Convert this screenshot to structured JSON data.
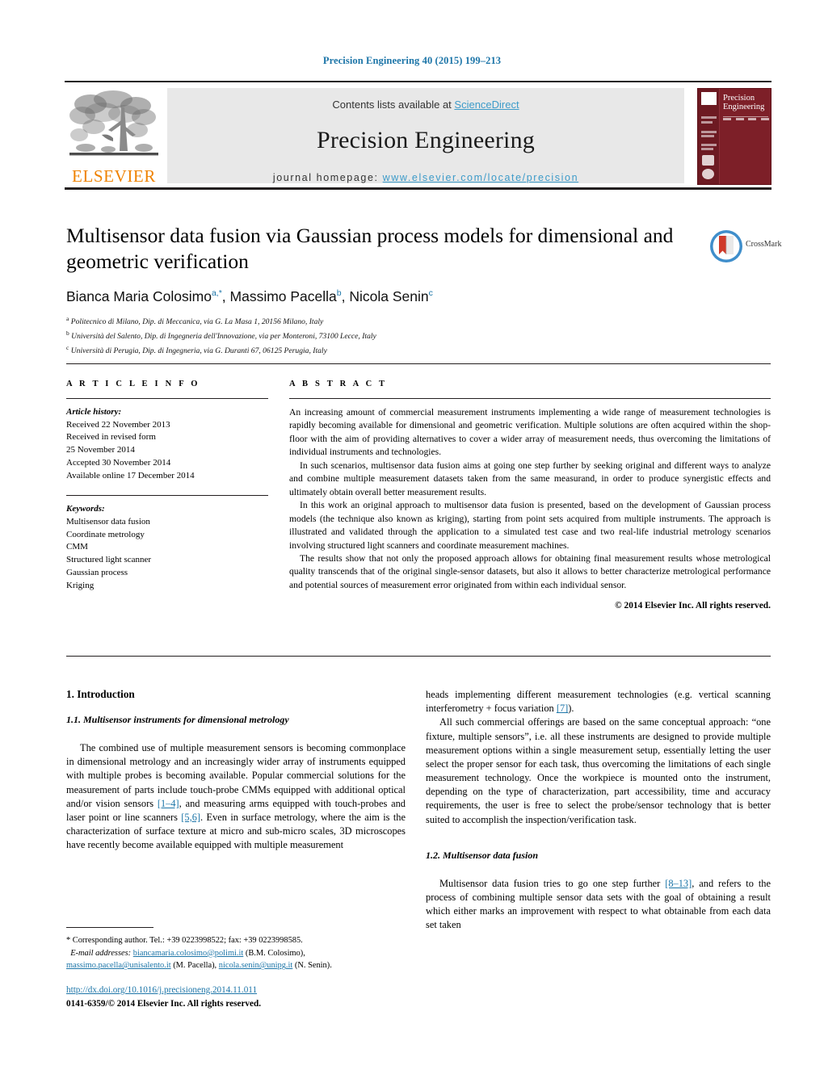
{
  "running_head": "Precision Engineering 40 (2015) 199–213",
  "masthead": {
    "contents_prefix": "Contents lists available at ",
    "contents_link": "ScienceDirect",
    "journal_title": "Precision Engineering",
    "homepage_prefix": "journal homepage: ",
    "homepage_url": "www.elsevier.com/locate/precision",
    "publisher_wordmark": "ELSEVIER",
    "cover_title_line1": "Precision",
    "cover_title_line2": "Engineering"
  },
  "article": {
    "title": "Multisensor data fusion via Gaussian process models for dimensional and geometric verification",
    "crossmark_label": "CrossMark",
    "authors": [
      {
        "name": "Bianca Maria Colosimo",
        "marks": "a,*"
      },
      {
        "name": "Massimo Pacella",
        "marks": "b"
      },
      {
        "name": "Nicola Senin",
        "marks": "c"
      }
    ],
    "authors_separator": ", ",
    "affiliations": [
      {
        "mark": "a",
        "text": "Politecnico di Milano, Dip. di Meccanica, via G. La Masa 1, 20156 Milano, Italy"
      },
      {
        "mark": "b",
        "text": "Università del Salento, Dip. di Ingegneria dell'Innovazione, via per Monteroni, 73100 Lecce, Italy"
      },
      {
        "mark": "c",
        "text": "Università di Perugia, Dip. di Ingegneria, via G. Duranti 67, 06125 Perugia, Italy"
      }
    ]
  },
  "article_info": {
    "heading": "A R T I C L E   I N F O",
    "history_label": "Article history:",
    "history": [
      "Received 22 November 2013",
      "Received in revised form",
      "25 November 2014",
      "Accepted 30 November 2014",
      "Available online 17 December 2014"
    ],
    "keywords_label": "Keywords:",
    "keywords": [
      "Multisensor data fusion",
      "Coordinate metrology",
      "CMM",
      "Structured light scanner",
      "Gaussian process",
      "Kriging"
    ]
  },
  "abstract": {
    "heading": "A B S T R A C T",
    "paragraphs": [
      "An increasing amount of commercial measurement instruments implementing a wide range of measurement technologies is rapidly becoming available for dimensional and geometric verification. Multiple solutions are often acquired within the shop-floor with the aim of providing alternatives to cover a wider array of measurement needs, thus overcoming the limitations of individual instruments and technologies.",
      "In such scenarios, multisensor data fusion aims at going one step further by seeking original and different ways to analyze and combine multiple measurement datasets taken from the same measurand, in order to produce synergistic effects and ultimately obtain overall better measurement results.",
      "In this work an original approach to multisensor data fusion is presented, based on the development of Gaussian process models (the technique also known as kriging), starting from point sets acquired from multiple instruments. The approach is illustrated and validated through the application to a simulated test case and two real-life industrial metrology scenarios involving structured light scanners and coordinate measurement machines.",
      "The results show that not only the proposed approach allows for obtaining final measurement results whose metrological quality transcends that of the original single-sensor datasets, but also it allows to better characterize metrological performance and potential sources of measurement error originated from within each individual sensor."
    ],
    "copyright": "© 2014 Elsevier Inc. All rights reserved."
  },
  "body": {
    "section1_heading": "1. Introduction",
    "section11_heading": "1.1. Multisensor instruments for dimensional metrology",
    "section12_heading": "1.2. Multisensor data fusion",
    "left_para_1a": "The combined use of multiple measurement sensors is becoming commonplace in dimensional metrology and an increasingly wider array of instruments equipped with multiple probes is becoming available. Popular commercial solutions for the measurement of parts include touch-probe CMMs equipped with additional optical and/or vision sensors ",
    "left_ref_1_4": "[1–4]",
    "left_para_1b": ", and measuring arms equipped with touch-probes and laser point or line scanners ",
    "left_ref_5_6": "[5,6]",
    "left_para_1c": ". Even in surface metrology, where the aim is the characterization of surface texture at micro and sub-micro scales, 3D microscopes have recently become available equipped with multiple measurement",
    "right_para_1a": "heads implementing different measurement technologies (e.g. vertical scanning interferometry + focus variation ",
    "right_ref_7": "[7]",
    "right_para_1b": ").",
    "right_para_2": "All such commercial offerings are based on the same conceptual approach: “one fixture, multiple sensors”, i.e. all these instruments are designed to provide multiple measurement options within a single measurement setup, essentially letting the user select the proper sensor for each task, thus overcoming the limitations of each single measurement technology. Once the workpiece is mounted onto the instrument, depending on the type of characterization, part accessibility, time and accuracy requirements, the user is free to select the probe/sensor technology that is better suited to accomplish the inspection/verification task.",
    "right_para_3a": "Multisensor data fusion tries to go one step further ",
    "right_ref_8_13": "[8–13]",
    "right_para_3b": ", and refers to the process of combining multiple sensor data sets with the goal of obtaining a result which either marks an improvement with respect to what obtainable from each data set taken"
  },
  "footnote": {
    "corresponding": "* Corresponding author. Tel.: +39 0223998522; fax: +39 0223998585.",
    "email_label": "E-mail addresses:",
    "email1": "biancamaria.colosimo@polimi.it",
    "email1_name": " (B.M. Colosimo),",
    "email2": "massimo.pacella@unisalento.it",
    "email2_name": " (M. Pacella),",
    "email3": "nicola.senin@unipg.it",
    "email3_name": " (N. Senin).",
    "doi": "http://dx.doi.org/10.1016/j.precisioneng.2014.11.011",
    "issn": "0141-6359/© 2014 Elsevier Inc. All rights reserved."
  },
  "colors": {
    "link_blue": "#1c75a8",
    "sciencedirect_blue": "#3d9bc9",
    "elsevier_orange": "#ef8200",
    "cover_maroon": "#7d1f28",
    "panel_gray": "#e8e8e8"
  }
}
